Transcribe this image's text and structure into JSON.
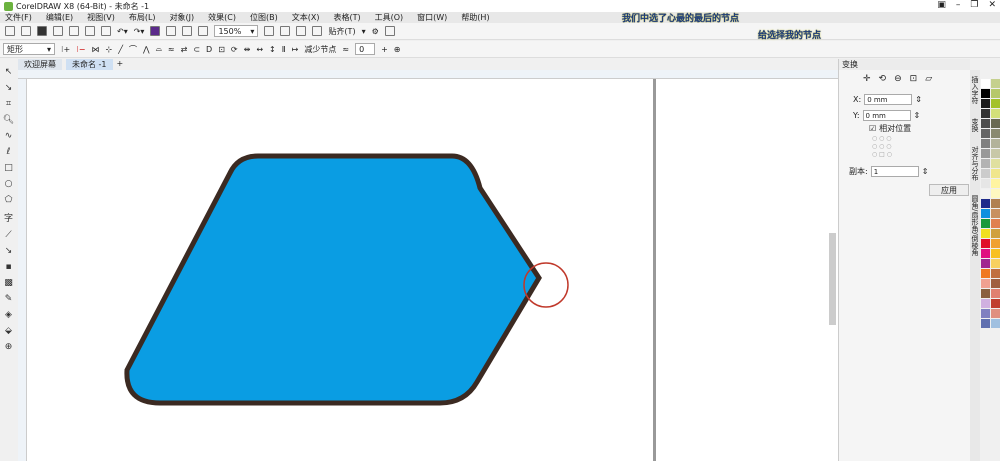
{
  "window": {
    "title": "CorelDRAW X8 (64-Bit) - 未命名 -1"
  },
  "menu": [
    "文件(F)",
    "编辑(E)",
    "视图(V)",
    "布局(L)",
    "对象(J)",
    "效果(C)",
    "位图(B)",
    "文本(X)",
    "表格(T)",
    "工具(O)",
    "窗口(W)",
    "帮助(H)"
  ],
  "toolbar": {
    "zoom": "150%",
    "snap": "贴齐(T)"
  },
  "property_bar": {
    "shape_type": "矩形",
    "reduce_nodes": "减少节点",
    "smoothness": "0"
  },
  "annotations": {
    "top": "我们中选了心最的最后的节点",
    "second": "给选择我的节点"
  },
  "tabs": [
    {
      "label": "欢迎屏幕"
    },
    {
      "label": "未命名 -1"
    }
  ],
  "docker": {
    "title": "变换",
    "x_label": "X:",
    "x_value": "0 mm",
    "y_label": "Y:",
    "y_value": "0 mm",
    "relative_label": "相对位置",
    "relative_checked": true,
    "copies_label": "副本:",
    "copies_value": "1",
    "apply_label": "应用"
  },
  "side_tabs": [
    "插入字符",
    "变换",
    "对齐与分布",
    "圆角/扇形角/倒棱角"
  ],
  "shape": {
    "fill": "#0a9de3",
    "outline": "#3b2a22",
    "highlight": "#c0392b"
  },
  "palette": [
    "#ffffff",
    "#c5d08e",
    "#000000",
    "#b6c86a",
    "#1a1a1a",
    "#a4c22a",
    "#333333",
    "#d3e07a",
    "#4d4d4d",
    "#6a6a52",
    "#666666",
    "#8a8a70",
    "#808080",
    "#b3b39a",
    "#999999",
    "#c8c8a8",
    "#b3b3b3",
    "#e0e0a0",
    "#cccccc",
    "#f0e68c",
    "#e6e6e6",
    "#fff4a0",
    "#f2f2f2",
    "#fff8c0",
    "#1e2a8a",
    "#b08050",
    "#0e90e0",
    "#c89060",
    "#1a9a3a",
    "#e08050",
    "#f0e020",
    "#d0a040",
    "#e0102a",
    "#f0a030",
    "#e01080",
    "#f8c020",
    "#a02890",
    "#f8d060",
    "#f07820",
    "#c07040",
    "#f0a090",
    "#a06040",
    "#8a6040",
    "#e08070",
    "#d0b0e0",
    "#c04030",
    "#8080c0",
    "#e09080",
    "#6070b0",
    "#a0c0e0"
  ]
}
